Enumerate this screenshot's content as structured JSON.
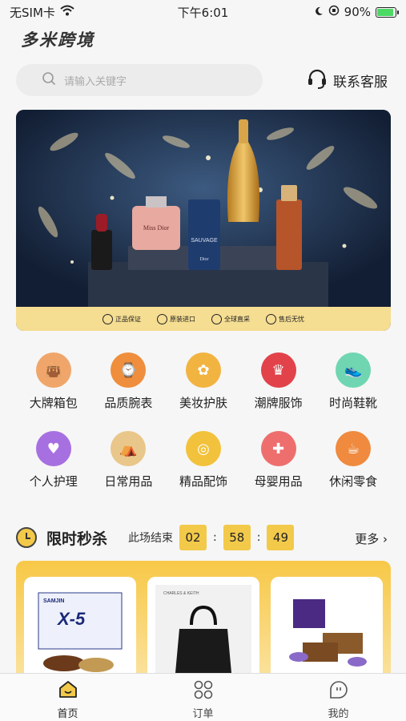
{
  "status_bar": {
    "carrier": "无SIM卡",
    "time": "下午6:01",
    "battery_percent": "90%",
    "battery_level": 0.9
  },
  "brand": "多米跨境",
  "search": {
    "placeholder": "请输入关键字"
  },
  "service_label": "联系客服",
  "banner": {
    "badges": [
      "正品保证",
      "原装进口",
      "全球直采",
      "售后无忧"
    ],
    "product_text": [
      "Miss Dior",
      "SAUVAGE",
      "Dior"
    ]
  },
  "categories": [
    {
      "label": "大牌箱包",
      "icon": "bag-icon",
      "color": "#f0a66a"
    },
    {
      "label": "品质腕表",
      "icon": "watch-icon",
      "color": "#ef8e3c"
    },
    {
      "label": "美妆护肤",
      "icon": "cosmetics-icon",
      "color": "#f2b441"
    },
    {
      "label": "潮牌服饰",
      "icon": "mannequin-icon",
      "color": "#e2424a"
    },
    {
      "label": "时尚鞋靴",
      "icon": "sneaker-icon",
      "color": "#6fd6b1"
    },
    {
      "label": "个人护理",
      "icon": "care-hand-icon",
      "color": "#a770e0"
    },
    {
      "label": "日常用品",
      "icon": "tent-icon",
      "color": "#e9c78a"
    },
    {
      "label": "精品配饰",
      "icon": "bracelet-icon",
      "color": "#f2c23c"
    },
    {
      "label": "母婴用品",
      "icon": "stroller-icon",
      "color": "#ee6e6e"
    },
    {
      "label": "休闲零食",
      "icon": "snack-icon",
      "color": "#ef8a3e"
    }
  ],
  "flash_sale": {
    "title": "限时秒杀",
    "ends_label": "此场结束",
    "hours": "02",
    "minutes": "58",
    "seconds": "49",
    "separator": ":",
    "more": "更多"
  },
  "products": [
    {
      "brand": "SAMJIN",
      "name": "X-5"
    },
    {
      "brand": "CHARLES & KEITH"
    },
    {
      "brand": ""
    }
  ],
  "tabbar": [
    {
      "label": "首页",
      "icon": "home-icon",
      "active": true
    },
    {
      "label": "订单",
      "icon": "grid-icon",
      "active": false
    },
    {
      "label": "我的",
      "icon": "profile-icon",
      "active": false
    }
  ],
  "colors": {
    "accent": "#f3c94a",
    "banner_bg": "#16253d",
    "strip": "#f5dd92"
  }
}
